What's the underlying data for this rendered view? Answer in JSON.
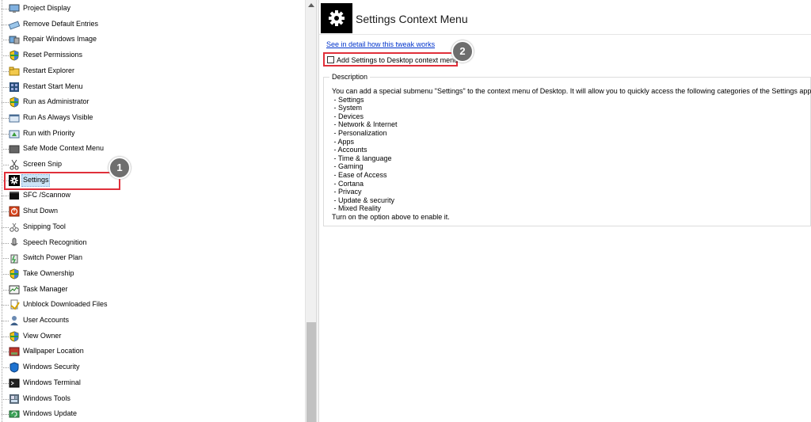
{
  "tree": {
    "items": [
      {
        "label": "Project Display",
        "icon": "monitor-pen-icon"
      },
      {
        "label": "Remove Default Entries",
        "icon": "eraser-icon"
      },
      {
        "label": "Repair Windows Image",
        "icon": "repair-icon"
      },
      {
        "label": "Reset Permissions",
        "icon": "uac-shield-icon"
      },
      {
        "label": "Restart Explorer",
        "icon": "folder-icon"
      },
      {
        "label": "Restart Start Menu",
        "icon": "start-menu-icon"
      },
      {
        "label": "Run as Administrator",
        "icon": "uac-shield-icon"
      },
      {
        "label": "Run As Always Visible",
        "icon": "window-icon"
      },
      {
        "label": "Run with Priority",
        "icon": "priority-icon"
      },
      {
        "label": "Safe Mode Context Menu",
        "icon": "safe-mode-icon"
      },
      {
        "label": "Screen Snip",
        "icon": "scissors-icon"
      },
      {
        "label": "Settings",
        "icon": "gear-icon",
        "selected": true
      },
      {
        "label": "SFC /Scannow",
        "icon": "console-icon"
      },
      {
        "label": "Shut Down",
        "icon": "power-icon"
      },
      {
        "label": "Snipping Tool",
        "icon": "snipping-tool-icon"
      },
      {
        "label": "Speech Recognition",
        "icon": "microphone-icon"
      },
      {
        "label": "Switch Power Plan",
        "icon": "power-plan-icon"
      },
      {
        "label": "Take Ownership",
        "icon": "uac-shield-icon"
      },
      {
        "label": "Task Manager",
        "icon": "task-manager-icon"
      },
      {
        "label": "Unblock Downloaded Files",
        "icon": "unblock-icon"
      },
      {
        "label": "User Accounts",
        "icon": "user-icon"
      },
      {
        "label": "View Owner",
        "icon": "uac-shield-icon"
      },
      {
        "label": "Wallpaper Location",
        "icon": "wallpaper-icon"
      },
      {
        "label": "Windows Security",
        "icon": "security-shield-icon"
      },
      {
        "label": "Windows Terminal",
        "icon": "terminal-icon"
      },
      {
        "label": "Windows Tools",
        "icon": "tools-icon"
      },
      {
        "label": "Windows Update",
        "icon": "update-icon"
      }
    ]
  },
  "header": {
    "title": "Settings Context Menu",
    "icon": "gear-icon"
  },
  "detail_link": "See in detail how this tweak works",
  "option": {
    "label": "Add Settings to Desktop context menu",
    "checked": false
  },
  "description": {
    "legend": "Description",
    "text": "You can add a special submenu \"Settings\" to the context menu of Desktop. It will allow you to quickly access the following categories of the Settings app:\n - Settings\n - System\n - Devices\n - Network & Internet\n - Personalization\n - Apps\n - Accounts\n - Time & language\n - Gaming\n - Ease of Access\n - Cortana\n - Privacy\n - Update & security\n - Mixed Reality\nTurn on the option above to enable it."
  },
  "annotations": {
    "badge_1": "1",
    "badge_2": "2"
  },
  "colors": {
    "highlight": "#e0303a",
    "badge": "#6e6e6e",
    "link": "#0033cc",
    "selection": "#cce4f7"
  }
}
